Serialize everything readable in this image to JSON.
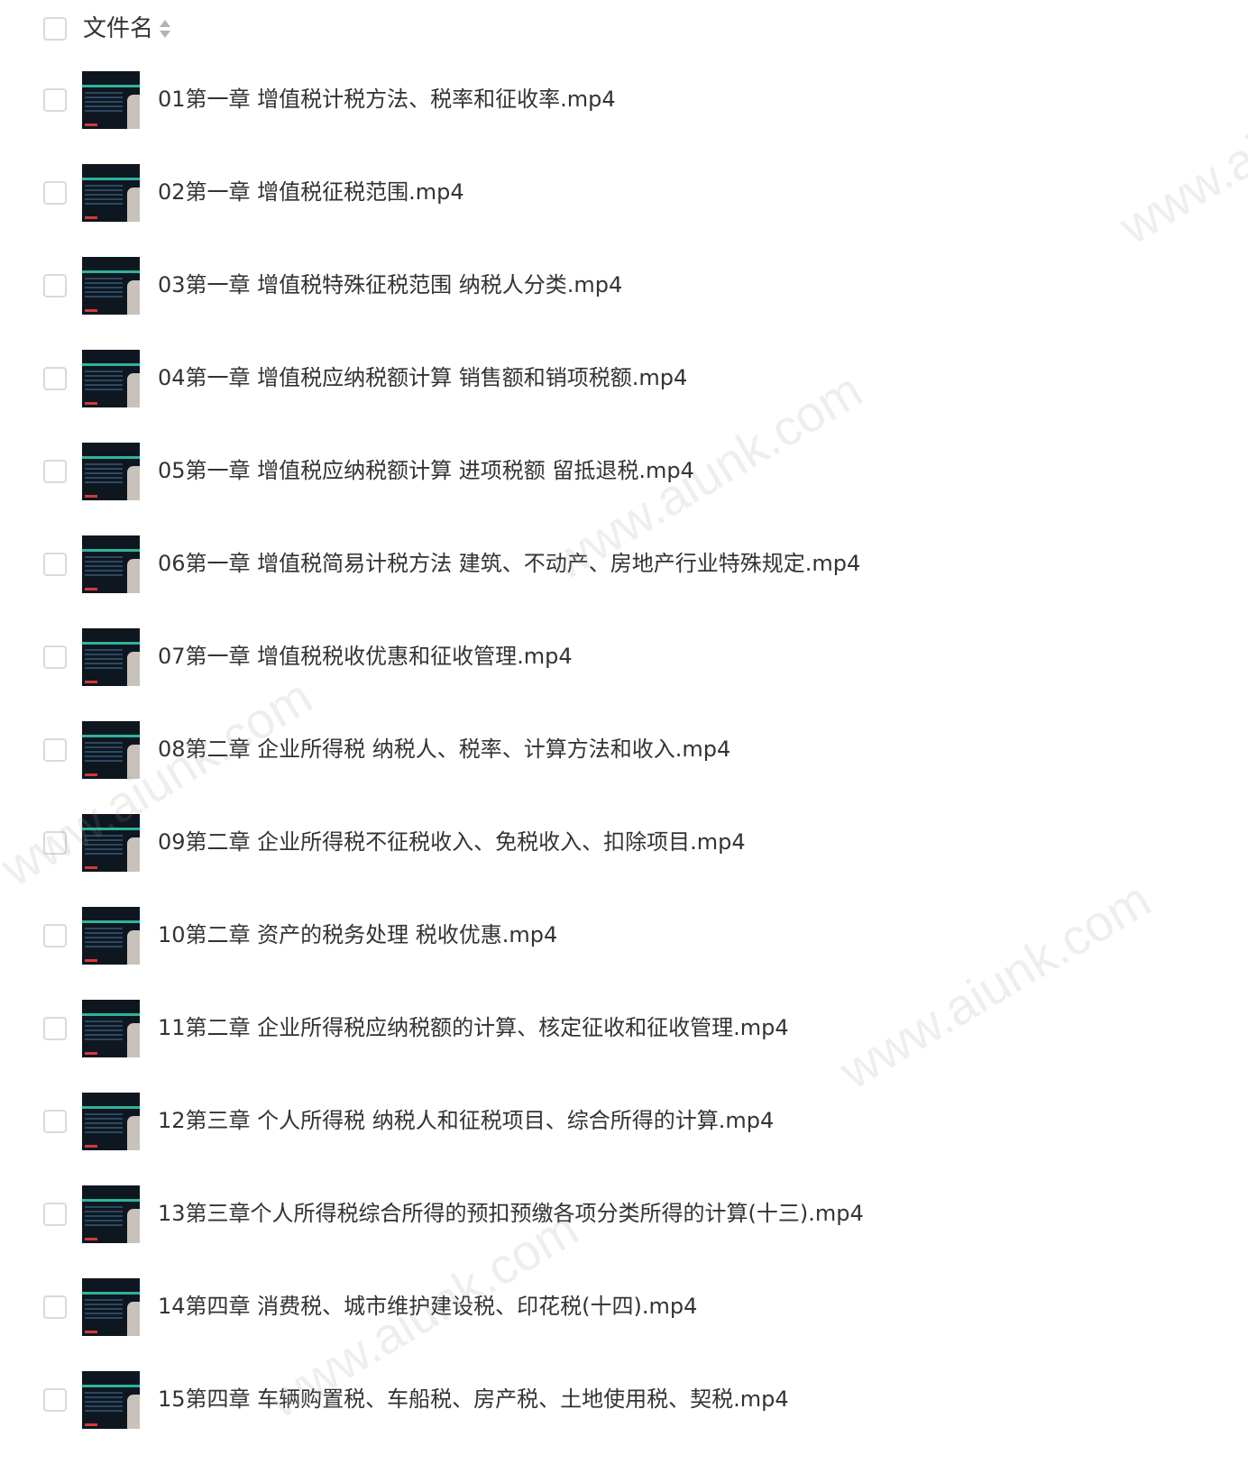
{
  "header": {
    "title": "文件名",
    "sort_icon": "sort-icon"
  },
  "files": [
    {
      "name": "01第一章 增值税计税方法、税率和征收率.mp4"
    },
    {
      "name": "02第一章 增值税征税范围.mp4"
    },
    {
      "name": "03第一章 增值税特殊征税范围 纳税人分类.mp4"
    },
    {
      "name": "04第一章 增值税应纳税额计算 销售额和销项税额.mp4"
    },
    {
      "name": "05第一章 增值税应纳税额计算 进项税额 留抵退税.mp4"
    },
    {
      "name": "06第一章 增值税简易计税方法 建筑、不动产、房地产行业特殊规定.mp4"
    },
    {
      "name": "07第一章 增值税税收优惠和征收管理.mp4"
    },
    {
      "name": "08第二章 企业所得税 纳税人、税率、计算方法和收入.mp4"
    },
    {
      "name": "09第二章 企业所得税不征税收入、免税收入、扣除项目.mp4"
    },
    {
      "name": "10第二章 资产的税务处理 税收优惠.mp4"
    },
    {
      "name": "11第二章 企业所得税应纳税额的计算、核定征收和征收管理.mp4"
    },
    {
      "name": "12第三章 个人所得税 纳税人和征税项目、综合所得的计算.mp4"
    },
    {
      "name": "13第三章个人所得税综合所得的预扣预缴各项分类所得的计算(十三).mp4"
    },
    {
      "name": "14第四章 消费税、城市维护建设税、印花税(十四).mp4"
    },
    {
      "name": "15第四章 车辆购置税、车船税、房产税、土地使用税、契税.mp4"
    }
  ],
  "watermark": "www.aiunk.com"
}
